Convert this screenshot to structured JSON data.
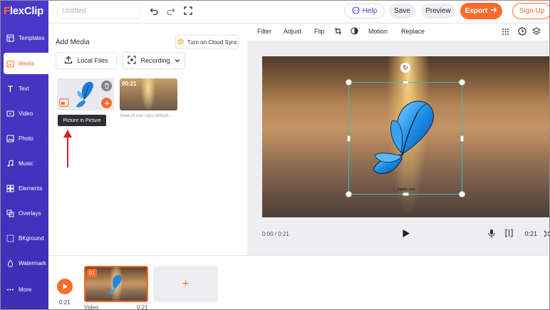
{
  "app": {
    "logo_first": "F",
    "logo_rest": "lexClip"
  },
  "sidebar": {
    "items": [
      {
        "label": "Templates",
        "icon": "templates-icon"
      },
      {
        "label": "Media",
        "icon": "media-icon",
        "active": true
      },
      {
        "label": "Text",
        "icon": "text-icon"
      },
      {
        "label": "Video",
        "icon": "video-icon"
      },
      {
        "label": "Photo",
        "icon": "photo-icon"
      },
      {
        "label": "Music",
        "icon": "music-icon"
      },
      {
        "label": "Elements",
        "icon": "elements-icon"
      },
      {
        "label": "Overlays",
        "icon": "overlays-icon"
      },
      {
        "label": "BKground",
        "icon": "background-icon"
      },
      {
        "label": "Watermark",
        "icon": "watermark-icon"
      },
      {
        "label": "More",
        "icon": "more-icon"
      }
    ]
  },
  "topbar": {
    "title_placeholder": "Untitled",
    "help_label": "Help",
    "save_label": "Save",
    "preview_label": "Preview",
    "export_label": "Export",
    "signup_label": "Sign Up"
  },
  "media_panel": {
    "title": "Add Media",
    "cloud_sync_label": "Turn on Cloud Sync",
    "local_files_label": "Local Files",
    "recording_label": "Recording",
    "thumb2_duration": "00:21",
    "thumb2_caption": "View of sun rays reflecti...",
    "tooltip": "Picture In Picture"
  },
  "edit_toolbar": {
    "filter": "Filter",
    "adjust": "Adjust",
    "flip": "Flip",
    "motion": "Motion",
    "replace": "Replace"
  },
  "player": {
    "current_time": "0:00 / 0:21",
    "duration": "0:21",
    "watermark": "inpixio.com"
  },
  "timeline": {
    "total_time": "0:21",
    "clip_number": "01",
    "clip_label": "Video",
    "clip_duration": "0:21",
    "add_symbol": "+"
  },
  "colors": {
    "brand": "#ff6a2b",
    "sidebar": "#4b37c9",
    "selection": "#2fc1bd"
  }
}
